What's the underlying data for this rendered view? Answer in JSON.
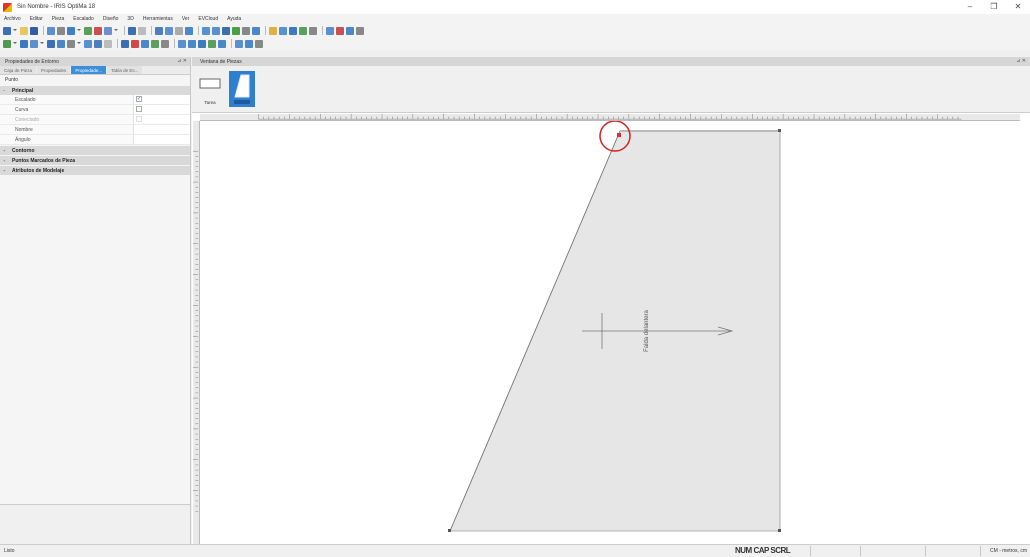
{
  "window": {
    "title": "Sin Nombre - IRIS OptiMa 18",
    "minimize": "–",
    "maximize": "❐",
    "close": "✕"
  },
  "menu": [
    "Archivo",
    "Editar",
    "Pieza",
    "Escalado",
    "Diseño",
    "3D",
    "Herramientas",
    "Ver",
    "EVCloud",
    "Ayuda"
  ],
  "left_panel": {
    "title": "Propiedades de Entorno",
    "pin": "⊿ ✕",
    "tabs": [
      "Caja de Pieza",
      "Propiedades",
      "Propiedade...",
      "Tabla de Es..."
    ],
    "active_tab": 2,
    "subtitle": "Punto",
    "sections": {
      "principal": "Principal",
      "contorno": "Contorno",
      "puntos": "Puntos Marcados de Pieza",
      "atributos": "Atributos de Modelaje"
    },
    "rows": {
      "escalado": "Escalado",
      "curva": "Curva",
      "conectado": "Conectado",
      "nombre": "Nombre",
      "angulo": "Ángulo"
    },
    "checks": {
      "escalado": "✓",
      "curva": "",
      "conectado": ""
    }
  },
  "view_panel": {
    "title": "Ventana de Piezas",
    "pin": "⊿ ✕",
    "part_label": "Tarea"
  },
  "canvas": {
    "piece_label": "Falda delantera"
  },
  "status": {
    "left": "Listo",
    "middle": "NUM CAP SCRL",
    "right": "CM - metros, cm"
  },
  "colors": {
    "accent": "#3a8fd8",
    "highlight": "#d82020",
    "piece_fill": "#e6e6e6"
  }
}
